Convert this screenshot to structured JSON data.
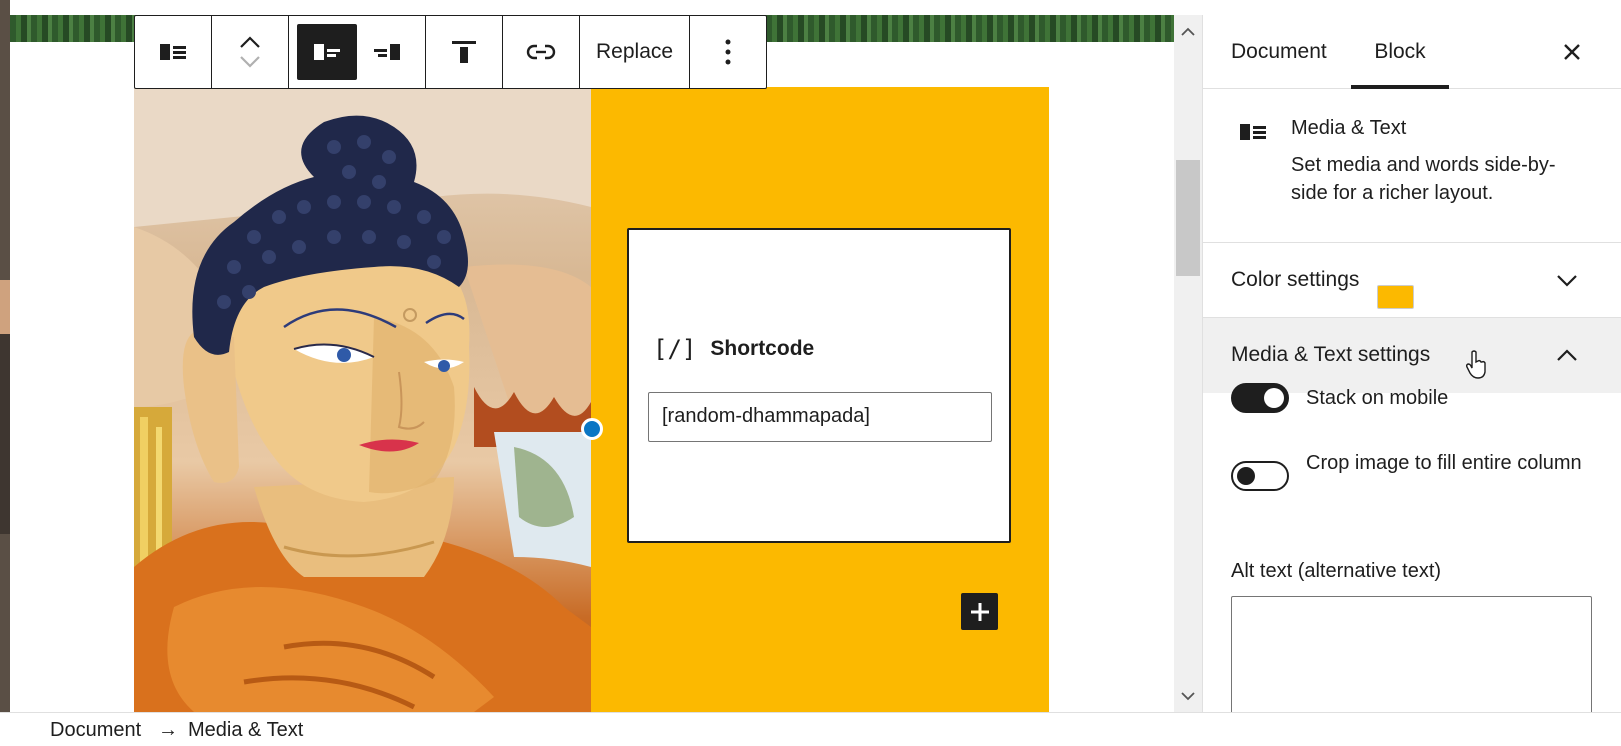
{
  "toolbar": {
    "block_type_icon": "media-text-icon",
    "move_icon": "chevron-up-down-icon",
    "media_left_icon": "pull-left-icon",
    "media_right_icon": "pull-right-icon",
    "align_top_icon": "align-top-icon",
    "link_icon": "link-icon",
    "replace_label": "Replace",
    "more_icon": "more-vertical-icon"
  },
  "block": {
    "shortcode_icon": "[/]",
    "shortcode_label": "Shortcode",
    "shortcode_value": "[random-dhammapada]",
    "background_color": "#fcb900",
    "add_icon": "plus-icon"
  },
  "sidebar": {
    "tabs": [
      {
        "label": "Document"
      },
      {
        "label": "Block"
      }
    ],
    "active_tab": "Block",
    "close_icon": "close-icon",
    "block_card": {
      "name": "Media & Text",
      "description": "Set media and words side-by-side for a richer layout."
    },
    "color_settings": {
      "label": "Color settings",
      "swatch_color": "#fcb900"
    },
    "media_text_settings": {
      "label": "Media & Text settings",
      "stack_on_mobile": {
        "label": "Stack on mobile",
        "checked": true
      },
      "crop_image": {
        "label": "Crop image to fill entire column",
        "checked": false
      },
      "alt_text_label": "Alt text (alternative text)",
      "alt_text_value": ""
    }
  },
  "breadcrumb": {
    "root": "Document",
    "separator": "→",
    "current": "Media & Text"
  }
}
